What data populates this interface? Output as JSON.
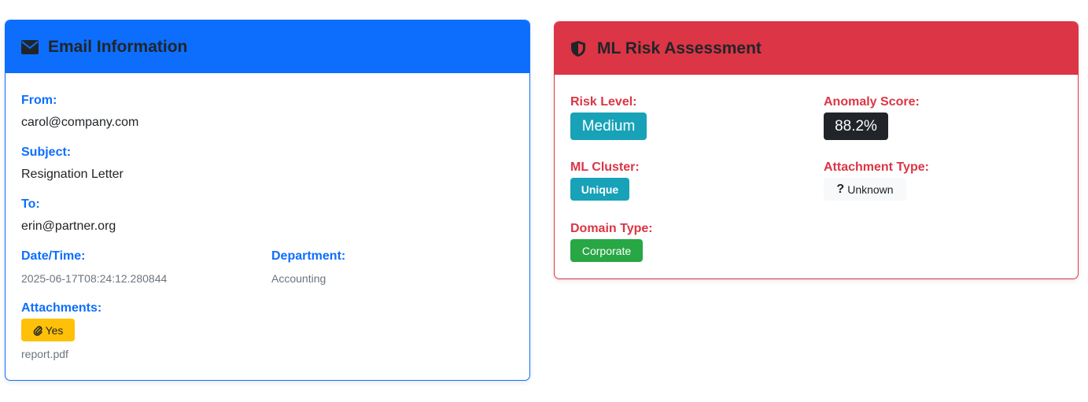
{
  "email_info": {
    "title": "Email Information",
    "from_label": "From:",
    "from_value": "carol@company.com",
    "subject_label": "Subject:",
    "subject_value": "Resignation Letter",
    "to_label": "To:",
    "to_value": "erin@partner.org",
    "datetime_label": "Date/Time:",
    "datetime_value": "2025-06-17T08:24:12.280844",
    "department_label": "Department:",
    "department_value": "Accounting",
    "attachments_label": "Attachments:",
    "attachments_badge": "Yes",
    "attachment_file": "report.pdf",
    "icons": [
      "envelope-icon",
      "paperclip-icon"
    ]
  },
  "risk": {
    "title": "ML Risk Assessment",
    "risk_level_label": "Risk Level:",
    "risk_level_value": "Medium",
    "anomaly_label": "Anomaly Score:",
    "anomaly_value": "88.2%",
    "cluster_label": "ML Cluster:",
    "cluster_value": "Unique",
    "attachment_type_label": "Attachment Type:",
    "attachment_type_value": "Unknown",
    "domain_type_label": "Domain Type:",
    "domain_type_value": "Corporate",
    "icons": [
      "shield-icon",
      "question-icon"
    ]
  },
  "colors": {
    "primary": "#0d6efd",
    "danger": "#dc3545",
    "info": "#17a2b8",
    "dark": "#212529",
    "success": "#28a745",
    "warning": "#ffc107",
    "light": "#f8f9fa"
  }
}
